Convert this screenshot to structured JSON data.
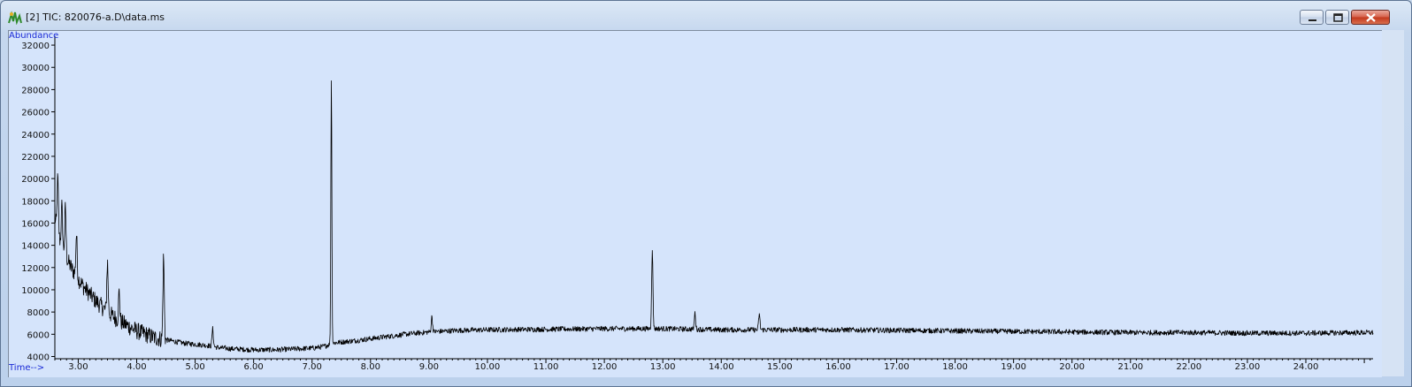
{
  "window": {
    "title": "[2] TIC: 820076-a.D\\data.ms",
    "controls": [
      "minimize",
      "maximize",
      "close"
    ],
    "icon": "chromatogram-app-icon"
  },
  "chart_data": {
    "type": "line",
    "title": "",
    "ylabel": "Abundance",
    "xlabel": "Time-->",
    "xlim": [
      2.6,
      25.15
    ],
    "ylim": [
      3800,
      32800
    ],
    "x_ticks": [
      "3.00",
      "4.00",
      "5.00",
      "6.00",
      "7.00",
      "8.00",
      "9.00",
      "10.00",
      "11.00",
      "12.00",
      "13.00",
      "14.00",
      "15.00",
      "16.00",
      "17.00",
      "18.00",
      "19.00",
      "20.00",
      "21.00",
      "22.00",
      "23.00",
      "24.00"
    ],
    "y_ticks": [
      "4000",
      "6000",
      "8000",
      "10000",
      "12000",
      "14000",
      "16000",
      "18000",
      "20000",
      "22000",
      "24000",
      "26000",
      "28000",
      "30000",
      "32000"
    ],
    "grid": false,
    "colors": {
      "trace": "#000000",
      "background": "#d5e4fb",
      "axis_label": "#1a2ad6"
    },
    "series": [
      {
        "x": [
          2.6,
          2.65,
          2.7,
          2.75,
          2.8,
          2.9,
          3.0,
          3.1,
          3.2,
          3.3,
          3.4,
          3.5,
          3.6,
          3.7,
          3.8,
          3.9,
          4.0,
          4.1,
          4.2,
          4.3,
          4.4,
          4.6,
          4.8,
          5.0,
          5.2,
          5.4,
          5.6,
          5.8,
          6.0,
          6.2,
          6.4,
          6.6,
          6.8,
          7.0,
          7.2,
          7.35,
          7.5,
          7.7,
          8.0,
          8.3,
          8.6,
          9.0,
          9.5,
          10.0,
          11.0,
          12.0,
          12.5,
          13.0,
          14.0,
          15.0,
          16.0,
          17.0,
          18.0,
          19.0,
          20.0,
          21.0,
          22.0,
          23.0,
          24.0,
          25.0
        ],
        "y": [
          16500,
          15000,
          14200,
          13500,
          12800,
          11800,
          11000,
          10200,
          9600,
          9000,
          8500,
          8000,
          7600,
          7200,
          6900,
          6600,
          6300,
          6100,
          5900,
          5700,
          5600,
          5400,
          5200,
          5100,
          5000,
          4800,
          4700,
          4650,
          4600,
          4600,
          4600,
          4650,
          4700,
          4750,
          4900,
          5200,
          5300,
          5400,
          5600,
          5800,
          6000,
          6200,
          6350,
          6400,
          6450,
          6500,
          6500,
          6500,
          6400,
          6400,
          6400,
          6350,
          6300,
          6250,
          6200,
          6150,
          6150,
          6100,
          6100,
          6150
        ],
        "peaks": [
          {
            "x": 2.65,
            "y": 20000
          },
          {
            "x": 2.72,
            "y": 17500
          },
          {
            "x": 2.78,
            "y": 17300
          },
          {
            "x": 2.97,
            "y": 15000
          },
          {
            "x": 3.5,
            "y": 12500
          },
          {
            "x": 3.7,
            "y": 9800
          },
          {
            "x": 4.46,
            "y": 13000
          },
          {
            "x": 5.3,
            "y": 6500
          },
          {
            "x": 7.33,
            "y": 29200
          },
          {
            "x": 9.05,
            "y": 7600
          },
          {
            "x": 12.82,
            "y": 13400
          },
          {
            "x": 13.55,
            "y": 7900
          },
          {
            "x": 14.65,
            "y": 7800
          }
        ]
      }
    ]
  }
}
